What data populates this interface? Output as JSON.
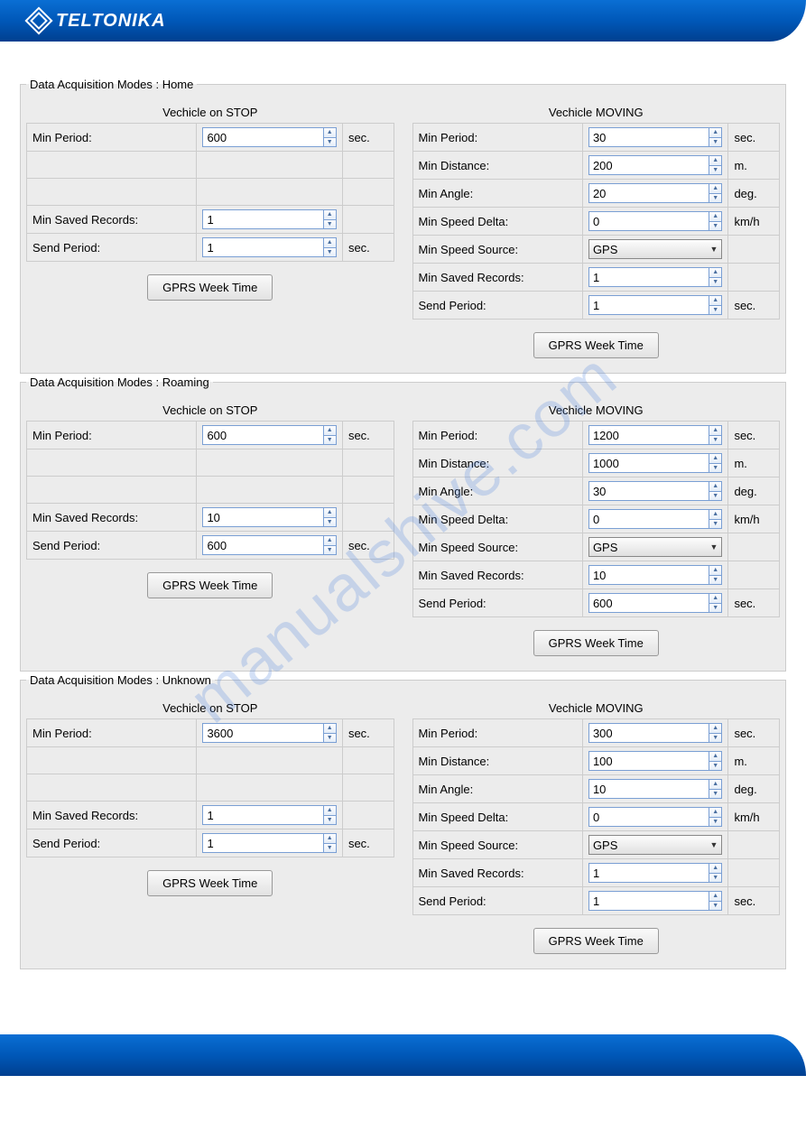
{
  "brand": "TELTONIKA",
  "watermark": "manualshive.com",
  "labels": {
    "min_period": "Min Period:",
    "min_distance": "Min Distance:",
    "min_angle": "Min Angle:",
    "min_speed_delta": "Min Speed Delta:",
    "min_speed_source": "Min Speed Source:",
    "min_saved_records": "Min Saved Records:",
    "send_period": "Send Period:",
    "stop_title": "Vechicle on STOP",
    "moving_title": "Vechicle MOVING",
    "gprs_btn": "GPRS Week Time"
  },
  "units": {
    "sec": "sec.",
    "m": "m.",
    "deg": "deg.",
    "kmh": "km/h"
  },
  "sections": {
    "home": {
      "legend": "Data Acquisition Modes : Home",
      "stop": {
        "min_period": "600",
        "min_saved_records": "1",
        "send_period": "1"
      },
      "moving": {
        "min_period": "30",
        "min_distance": "200",
        "min_angle": "20",
        "min_speed_delta": "0",
        "min_speed_source": "GPS",
        "min_saved_records": "1",
        "send_period": "1"
      }
    },
    "roaming": {
      "legend": "Data Acquisition Modes : Roaming",
      "stop": {
        "min_period": "600",
        "min_saved_records": "10",
        "send_period": "600"
      },
      "moving": {
        "min_period": "1200",
        "min_distance": "1000",
        "min_angle": "30",
        "min_speed_delta": "0",
        "min_speed_source": "GPS",
        "min_saved_records": "10",
        "send_period": "600"
      }
    },
    "unknown": {
      "legend": "Data Acquisition Modes : Unknown",
      "stop": {
        "min_period": "3600",
        "min_saved_records": "1",
        "send_period": "1"
      },
      "moving": {
        "min_period": "300",
        "min_distance": "100",
        "min_angle": "10",
        "min_speed_delta": "0",
        "min_speed_source": "GPS",
        "min_saved_records": "1",
        "send_period": "1"
      }
    }
  }
}
